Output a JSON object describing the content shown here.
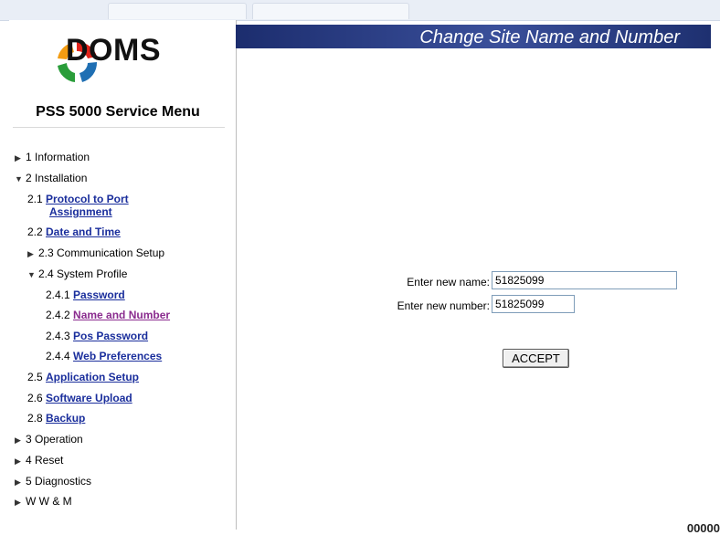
{
  "sidebar": {
    "logo_text": "DOMS",
    "menu_title": "PSS 5000 Service Menu",
    "items": [
      {
        "number": "1",
        "label": "Information",
        "link": false,
        "arrow": "▶"
      },
      {
        "number": "2",
        "label": "Installation",
        "link": false,
        "arrow": "▼"
      },
      {
        "number": "2.1",
        "label": "Protocol to Port Assignment",
        "link": true,
        "arrow": ""
      },
      {
        "number": "2.2",
        "label": "Date and Time",
        "link": true,
        "arrow": ""
      },
      {
        "number": "2.3",
        "label": "Communication Setup",
        "link": false,
        "arrow": "▶"
      },
      {
        "number": "2.4",
        "label": "System Profile",
        "link": false,
        "arrow": "▼"
      },
      {
        "number": "2.4.1",
        "label": "Password",
        "link": true,
        "arrow": ""
      },
      {
        "number": "2.4.2",
        "label": "Name and Number",
        "link": true,
        "arrow": "",
        "active": true
      },
      {
        "number": "2.4.3",
        "label": "Pos Password",
        "link": true,
        "arrow": ""
      },
      {
        "number": "2.4.4",
        "label": "Web Preferences",
        "link": true,
        "arrow": ""
      },
      {
        "number": "2.5",
        "label": "Application Setup",
        "link": true,
        "arrow": ""
      },
      {
        "number": "2.6",
        "label": "Software Upload",
        "link": true,
        "arrow": ""
      },
      {
        "number": "2.8",
        "label": "Backup",
        "link": true,
        "arrow": ""
      },
      {
        "number": "3",
        "label": "Operation",
        "link": false,
        "arrow": "▶"
      },
      {
        "number": "4",
        "label": "Reset",
        "link": false,
        "arrow": "▶"
      },
      {
        "number": "5",
        "label": "Diagnostics",
        "link": false,
        "arrow": "▶"
      },
      {
        "number": "",
        "label": "W W & M",
        "link": false,
        "arrow": "▶"
      }
    ]
  },
  "main": {
    "title": "Change Site Name and Number",
    "name_label": "Enter new name:",
    "name_value": "51825099",
    "number_label": "Enter new number:",
    "number_value": "51825099",
    "accept_label": "ACCEPT",
    "corner_text": "00000"
  },
  "colors": {
    "header_bar": "#1c2d6e",
    "link": "#1a2e9c",
    "link_active": "#8a2b8e"
  }
}
